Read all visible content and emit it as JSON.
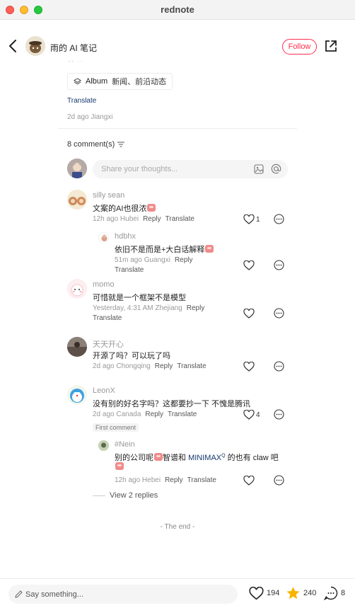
{
  "window": {
    "title": "rednote"
  },
  "header": {
    "author_name": "雨的 AI 笔记",
    "follow_label": "Follow"
  },
  "post": {
    "clipped_text": "前沿",
    "album_label": "Album",
    "album_topic": "新闻、前沿动态",
    "translate_label": "Translate",
    "meta": "2d ago Jiangxi"
  },
  "comments_header": {
    "count_label": "8 comment(s)"
  },
  "composer": {
    "placeholder": "Share your thoughts..."
  },
  "comments": [
    {
      "name": "silly sean",
      "text": "文案的AI也很浓",
      "time_location": "12h ago Hubei",
      "reply": "Reply",
      "translate": "Translate",
      "likes": "1"
    },
    {
      "name": "hdbhx",
      "text": "依旧不是而是+大白话解释",
      "time_location": "51m ago Guangxi",
      "reply": "Reply",
      "translate": "Translate",
      "likes": ""
    },
    {
      "name": "momo",
      "text": "可惜就是一个框架不是模型",
      "time_location": "Yesterday, 4:31 AM Zhejiang",
      "reply": "Reply",
      "translate": "Translate",
      "likes": ""
    },
    {
      "name": "天天开心",
      "text": "开源了吗？可以玩了吗",
      "time_location": "2d ago Chongqing",
      "reply": "Reply",
      "translate": "Translate",
      "likes": ""
    },
    {
      "name": "LeonX",
      "text": "没有别的好名字吗？这都要抄一下 不愧是腾讯",
      "time_location": "2d ago Canada",
      "reply": "Reply",
      "translate": "Translate",
      "likes": "4",
      "badge": "First comment"
    },
    {
      "name": "#Nein",
      "text_a": "别的公司呢",
      "text_b": "智谱和",
      "text_link": "MINIMAX",
      "text_sup": "Q",
      "text_c": " 的也有 claw 吧",
      "time_location": "12h ago Hebei",
      "reply": "Reply",
      "translate": "Translate",
      "likes": ""
    }
  ],
  "view_replies": "View 2 replies",
  "the_end": "- The end -",
  "bottom": {
    "say_placeholder": "Say something...",
    "likes": "194",
    "stars": "240",
    "comments": "8"
  },
  "colors": {
    "accent": "#ff2e4d",
    "link": "#13386c",
    "star": "#f7b500"
  }
}
